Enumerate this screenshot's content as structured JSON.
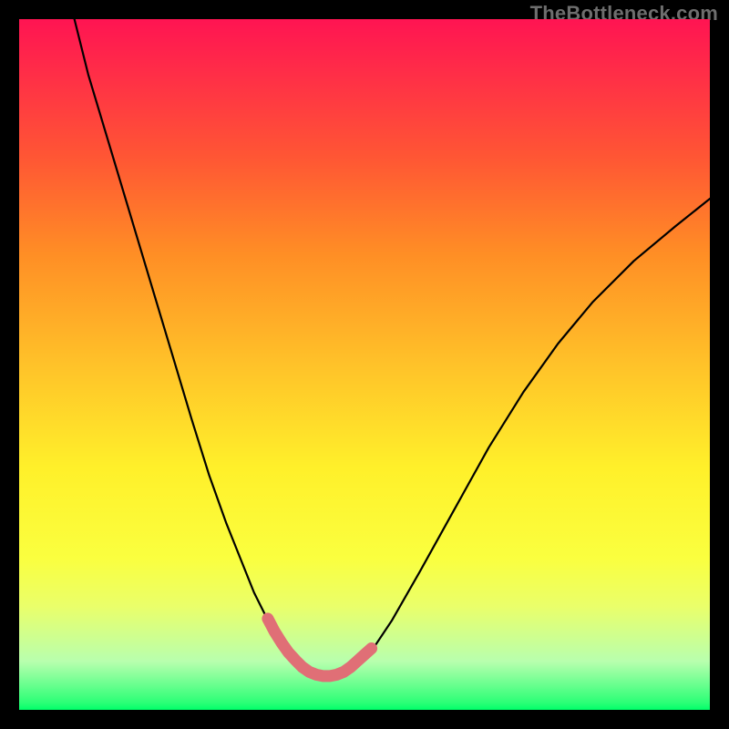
{
  "watermark": "TheBottleneck.com",
  "chart_data": {
    "type": "line",
    "title": "",
    "xlabel": "",
    "ylabel": "",
    "xlim": [
      0,
      100
    ],
    "ylim": [
      0,
      100
    ],
    "series": [
      {
        "name": "black-curve",
        "color": "#000000",
        "x": [
          8,
          10,
          13,
          16,
          19,
          22,
          25,
          27.5,
          30,
          32,
          34,
          36,
          38,
          40,
          42,
          44,
          46,
          48,
          51,
          54,
          58,
          63,
          68,
          73,
          78,
          83,
          89,
          95,
          100
        ],
        "values": [
          100,
          92,
          82,
          72,
          62,
          52,
          42,
          34,
          27,
          22,
          17,
          13,
          10,
          8,
          6,
          5,
          5,
          6,
          8.5,
          13,
          20,
          29,
          38,
          46,
          53,
          59,
          65,
          70,
          74
        ]
      },
      {
        "name": "pink-highlight",
        "color": "#e06f76",
        "x": [
          36,
          37,
          38,
          39,
          40,
          41,
          42,
          43,
          44,
          45,
          46,
          47,
          48,
          49,
          50,
          51
        ],
        "values": [
          13.2,
          11.3,
          9.7,
          8.3,
          7.2,
          6.2,
          5.5,
          5.1,
          4.9,
          4.9,
          5.1,
          5.5,
          6.2,
          7.1,
          8.0,
          8.9
        ]
      }
    ]
  }
}
